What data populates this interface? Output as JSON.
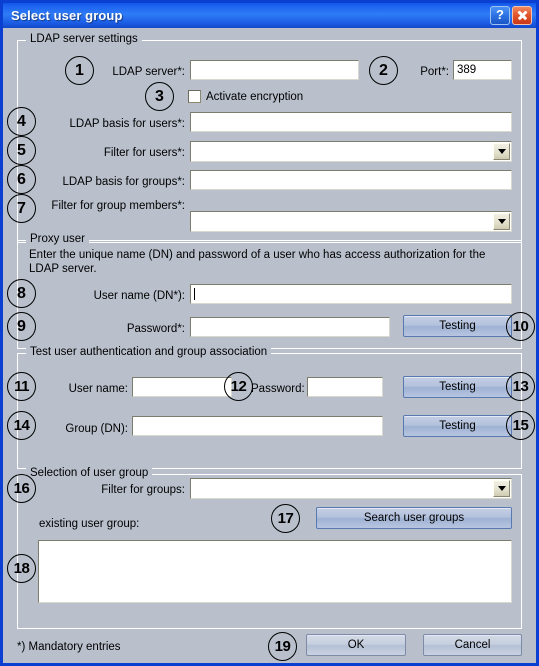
{
  "window": {
    "title": "Select user group",
    "help_button": "?",
    "close_button": "close-icon"
  },
  "groups": {
    "ldap": {
      "legend": "LDAP server settings"
    },
    "proxy": {
      "legend": "Proxy user",
      "description": "Enter the unique name (DN) and password of a user who has access authorization for the LDAP server."
    },
    "test": {
      "legend": "Test user authentication and group association"
    },
    "selection": {
      "legend": "Selection of user group"
    }
  },
  "ldap": {
    "server_label": "LDAP server*:",
    "server_value": "",
    "port_label": "Port*:",
    "port_value": "389",
    "encryption_label": "Activate encryption",
    "encryption_checked": false,
    "basis_users_label": "LDAP basis for users*:",
    "basis_users_value": "",
    "filter_users_label": "Filter for users*:",
    "filter_users_value": "",
    "basis_groups_label": "LDAP basis for groups*:",
    "basis_groups_value": "",
    "filter_group_members_label": "Filter for group members*:",
    "filter_group_members_value": ""
  },
  "proxy": {
    "username_label": "User name (DN*):",
    "username_value": "",
    "password_label": "Password*:",
    "password_value": "",
    "test_button": "Testing"
  },
  "test": {
    "username_label": "User name:",
    "username_value": "",
    "password_label": "Password:",
    "password_value": "",
    "test_button_1": "Testing",
    "group_label": "Group (DN):",
    "group_value": "",
    "test_button_2": "Testing"
  },
  "selection": {
    "filter_groups_label": "Filter for groups:",
    "filter_groups_value": "",
    "search_button": "Search user groups",
    "existing_label": "existing user group:",
    "list_items": []
  },
  "footer": {
    "mandatory_note": "*) Mandatory entries",
    "ok_button": "OK",
    "cancel_button": "Cancel"
  },
  "callouts": [
    {
      "n": "1"
    },
    {
      "n": "2"
    },
    {
      "n": "3"
    },
    {
      "n": "4"
    },
    {
      "n": "5"
    },
    {
      "n": "6"
    },
    {
      "n": "7"
    },
    {
      "n": "8"
    },
    {
      "n": "9"
    },
    {
      "n": "10"
    },
    {
      "n": "11"
    },
    {
      "n": "12"
    },
    {
      "n": "13"
    },
    {
      "n": "14"
    },
    {
      "n": "15"
    },
    {
      "n": "16"
    },
    {
      "n": "17"
    },
    {
      "n": "18"
    },
    {
      "n": "19"
    }
  ],
  "colors": {
    "titlebar_blue": "#1d64ef",
    "window_border": "#0a3fd1",
    "dialog_bg": "#b9c0cc",
    "button_blue": "#b3c1dc",
    "close_red": "#e2542a"
  }
}
